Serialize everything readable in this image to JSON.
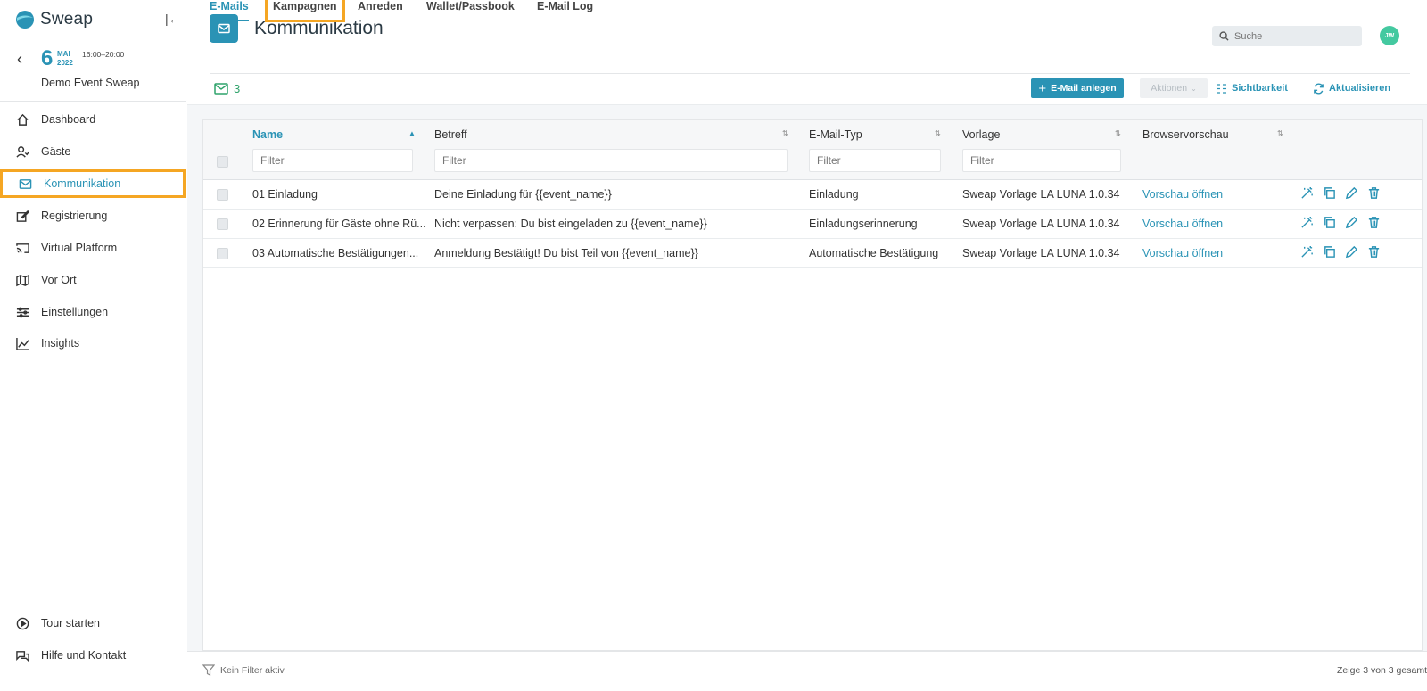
{
  "app": {
    "name": "Sweap"
  },
  "event": {
    "day": "6",
    "month": "MAI",
    "year": "2022",
    "time": "16:00–20:00",
    "name": "Demo Event Sweap"
  },
  "nav": [
    {
      "label": "Dashboard",
      "icon": "home-icon"
    },
    {
      "label": "Gäste",
      "icon": "guests-icon"
    },
    {
      "label": "Kommunikation",
      "icon": "mail-icon",
      "active": true
    },
    {
      "label": "Registrierung",
      "icon": "edit-icon"
    },
    {
      "label": "Virtual Platform",
      "icon": "cast-icon"
    },
    {
      "label": "Vor Ort",
      "icon": "map-icon"
    },
    {
      "label": "Einstellungen",
      "icon": "sliders-icon"
    },
    {
      "label": "Insights",
      "icon": "chart-icon"
    }
  ],
  "nav_bottom": [
    {
      "label": "Tour starten",
      "icon": "play-icon"
    },
    {
      "label": "Hilfe und Kontakt",
      "icon": "chat-icon"
    }
  ],
  "page": {
    "title": "Kommunikation"
  },
  "search": {
    "placeholder": "Suche"
  },
  "user": {
    "initials": "JW"
  },
  "tabs": [
    {
      "label": "E-Mails",
      "active": true
    },
    {
      "label": "Kampagnen",
      "highlight": true
    },
    {
      "label": "Anreden"
    },
    {
      "label": "Wallet/Passbook"
    },
    {
      "label": "E-Mail Log"
    }
  ],
  "toolbar": {
    "count": "3",
    "create_label": "E-Mail anlegen",
    "actions_label": "Aktionen",
    "visibility_label": "Sichtbarkeit",
    "refresh_label": "Aktualisieren"
  },
  "table": {
    "columns": [
      "Name",
      "Betreff",
      "E-Mail-Typ",
      "Vorlage",
      "Browservorschau"
    ],
    "filter_placeholder": "Filter",
    "rows": [
      {
        "name": "01 Einladung",
        "subject": "Deine Einladung für {{event_name}}",
        "type": "Einladung",
        "template": "Sweap Vorlage LA LUNA 1.0.34",
        "preview": "Vorschau öffnen"
      },
      {
        "name": "02 Erinnerung für Gäste ohne Rü...",
        "subject": "Nicht verpassen: Du bist eingeladen zu {{event_name}}",
        "type": "Einladungserinnerung",
        "template": "Sweap Vorlage LA LUNA 1.0.34",
        "preview": "Vorschau öffnen"
      },
      {
        "name": "03 Automatische Bestätigungen...",
        "subject": "Anmeldung Bestätigt! Du bist Teil von {{event_name}}",
        "type": "Automatische Bestätigung",
        "template": "Sweap Vorlage LA LUNA 1.0.34",
        "preview": "Vorschau öffnen"
      }
    ]
  },
  "footer": {
    "filter_status": "Kein Filter aktiv",
    "summary": "Zeige 3 von 3 gesamt"
  },
  "colors": {
    "accent": "#2a93b5",
    "highlight": "#f5a623",
    "success": "#2fa36b",
    "avatar": "#44c9a0"
  }
}
